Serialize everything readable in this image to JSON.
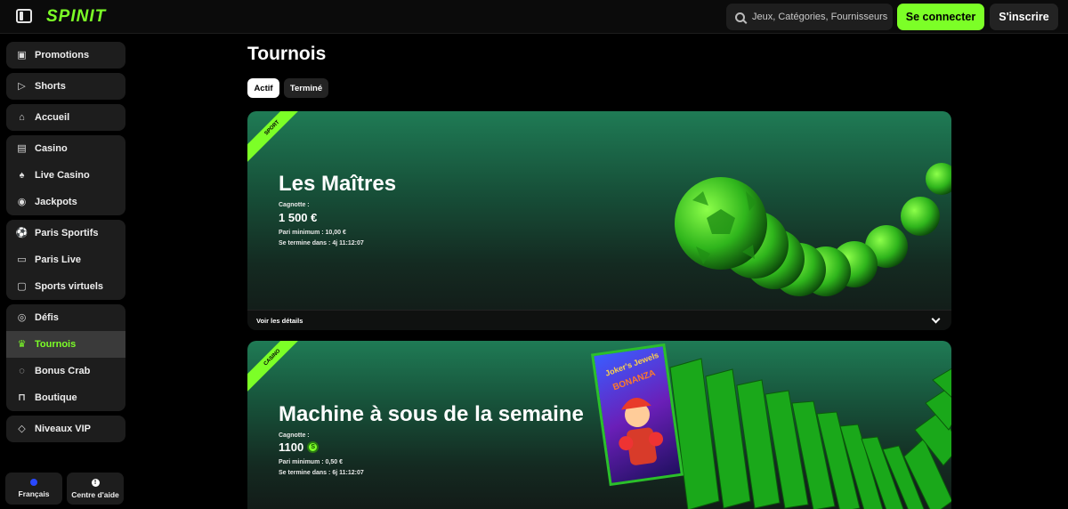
{
  "header": {
    "logo": "SPINIT",
    "search_placeholder": "Jeux, Catégories, Fournisseurs",
    "login_label": "Se connecter",
    "signup_label": "S'inscrire"
  },
  "sidebar": {
    "groups": [
      [
        {
          "label": "Promotions",
          "icon": "tag-icon"
        }
      ],
      [
        {
          "label": "Shorts",
          "icon": "play-icon"
        }
      ],
      [
        {
          "label": "Accueil",
          "icon": "home-icon"
        }
      ],
      [
        {
          "label": "Casino",
          "icon": "slot-icon"
        },
        {
          "label": "Live Casino",
          "icon": "cards-icon"
        },
        {
          "label": "Jackpots",
          "icon": "jackpot-icon"
        }
      ],
      [
        {
          "label": "Paris Sportifs",
          "icon": "ball-icon"
        },
        {
          "label": "Paris Live",
          "icon": "live-icon"
        },
        {
          "label": "Sports virtuels",
          "icon": "monitor-icon"
        }
      ],
      [
        {
          "label": "Défis",
          "icon": "badge-icon"
        },
        {
          "label": "Tournois",
          "icon": "trophy-icon",
          "active": true
        },
        {
          "label": "Bonus Crab",
          "icon": "crab-icon"
        },
        {
          "label": "Boutique",
          "icon": "bag-icon"
        }
      ],
      [
        {
          "label": "Niveaux VIP",
          "icon": "diamond-icon"
        }
      ]
    ],
    "language_label": "Français",
    "help_label": "Centre d'aide"
  },
  "main": {
    "title": "Tournois",
    "tabs": [
      {
        "label": "Actif",
        "active": true
      },
      {
        "label": "Terminé",
        "active": false
      }
    ],
    "tournaments": [
      {
        "tag": "SPORT",
        "title": "Les Maîtres",
        "prize_label": "Cagnotte :",
        "prize_value": "1 500 €",
        "min_bet_label": "Pari minimum :",
        "min_bet_value": "10,00 €",
        "ends_label": "Se termine dans :",
        "ends_value": "4j 11:12:07",
        "details_label": "Voir les détails"
      },
      {
        "tag": "CASINO",
        "title": "Machine à sous de la semaine",
        "prize_label": "Cagnotte :",
        "prize_value": "1100",
        "prize_coin": "S",
        "min_bet_label": "Pari minimum :",
        "min_bet_value": "0,50 €",
        "ends_label": "Se termine dans :",
        "ends_value": "6j 11:12:07",
        "slot_title": "Joker's Jewels",
        "slot_subtitle": "BONANZA"
      }
    ]
  },
  "colors": {
    "accent": "#7cff27",
    "background": "#000000",
    "panel": "#1d1d1d"
  }
}
